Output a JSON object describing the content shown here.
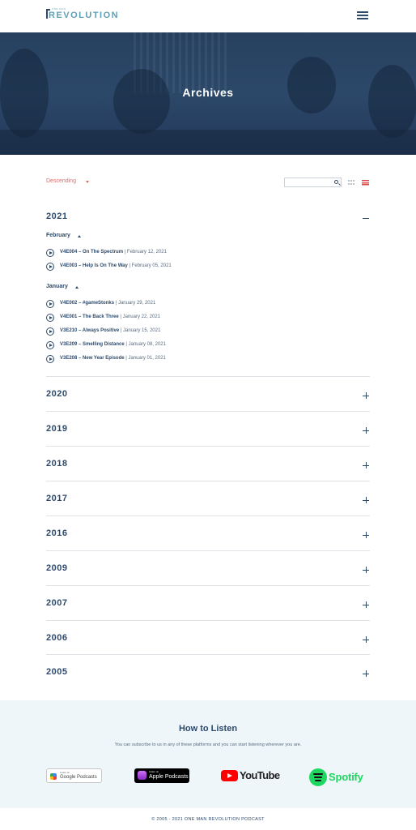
{
  "header": {
    "logo_small": "ONE MAN",
    "logo_word": "REVOLUTION",
    "menu_icon": "hamburger-menu-icon"
  },
  "hero": {
    "title": "Archives"
  },
  "controls": {
    "sort_label": "Descending",
    "search_placeholder": "",
    "search_icon": "search-icon",
    "grid_icon": "grid-view-icon",
    "list_icon": "list-view-icon",
    "active_color": "#e04848"
  },
  "years": [
    {
      "label": "2021",
      "expanded": true,
      "months": [
        {
          "label": "February",
          "episodes": [
            {
              "title": "V4E004 – On The Spectrum",
              "date": " | February 12, 2021"
            },
            {
              "title": "V4E003 – Help Is On The Way",
              "date": " | February 05, 2021"
            }
          ]
        },
        {
          "label": "January",
          "episodes": [
            {
              "title": "V4E002 – #gameStonks",
              "date": " | January 29, 2021"
            },
            {
              "title": "V4E001 – The Back Three",
              "date": " | January 22, 2021"
            },
            {
              "title": "V3E210 – Always Positive",
              "date": " | January 15, 2021"
            },
            {
              "title": "V3E209 – Smelling Distance",
              "date": " | January 08, 2021"
            },
            {
              "title": "V3E208 – New Year Episode",
              "date": " | January 01, 2021"
            }
          ]
        }
      ]
    },
    {
      "label": "2020",
      "expanded": false
    },
    {
      "label": "2019",
      "expanded": false
    },
    {
      "label": "2018",
      "expanded": false
    },
    {
      "label": "2017",
      "expanded": false
    },
    {
      "label": "2016",
      "expanded": false
    },
    {
      "label": "2009",
      "expanded": false
    },
    {
      "label": "2007",
      "expanded": false
    },
    {
      "label": "2006",
      "expanded": false
    },
    {
      "label": "2005",
      "expanded": false
    }
  ],
  "listen": {
    "title": "How to Listen",
    "subtitle": "You can subscribe to us in any of these platforms and you can start listening wherever you are.",
    "google": {
      "small": "Listen on",
      "big": "Google Podcasts"
    },
    "apple": {
      "small": "Listen on",
      "big": "Apple Podcasts"
    },
    "youtube": {
      "word": "YouTube"
    },
    "spotify": {
      "word": "Spotify"
    }
  },
  "footer": {
    "text": "© 2005 - 2021 ONE MAN REVOLUTION PODCAST"
  }
}
